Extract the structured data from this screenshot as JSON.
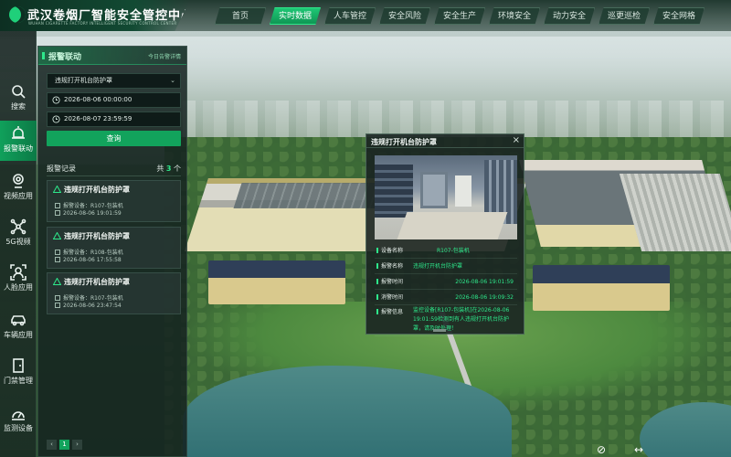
{
  "brand": {
    "title": "武汉卷烟厂智能安全管控中心",
    "subtitle": "WUHAN CIGARETTE FACTORY INTELLIGENT SECURITY CONTROL CENTER"
  },
  "nav": [
    {
      "label": "首页",
      "active": false
    },
    {
      "label": "实时数据",
      "active": true
    },
    {
      "label": "人车管控",
      "active": false
    },
    {
      "label": "安全风险",
      "active": false
    },
    {
      "label": "安全生产",
      "active": false
    },
    {
      "label": "环境安全",
      "active": false
    },
    {
      "label": "动力安全",
      "active": false
    },
    {
      "label": "巡更巡检",
      "active": false
    },
    {
      "label": "安全网格",
      "active": false
    }
  ],
  "rail": [
    {
      "label": "搜索",
      "icon": "search-icon"
    },
    {
      "label": "报警联动",
      "icon": "alarm-bell-icon",
      "active": true
    },
    {
      "label": "视频应用",
      "icon": "camera-icon"
    },
    {
      "label": "5G视频",
      "icon": "5g-network-icon"
    },
    {
      "label": "人脸应用",
      "icon": "face-scan-icon"
    },
    {
      "label": "车辆应用",
      "icon": "car-icon"
    },
    {
      "label": "门禁管理",
      "icon": "door-icon"
    },
    {
      "label": "监测设备",
      "icon": "monitor-device-icon"
    }
  ],
  "panel": {
    "title": "报警联动",
    "hint": "今日告警详情",
    "filter_type": "违规打开机台防护罩",
    "start_time": "2026-08-06 00:00:00",
    "end_time": "2026-08-07 23:59:59",
    "query_label": "查询",
    "records_label": "报警记录",
    "count_prefix": "共",
    "count": "3",
    "count_suffix": "个",
    "records": [
      {
        "title": "违规打开机台防护罩",
        "device": "报警设备：R107-包装机",
        "time": "2026-08-06 19:01:59"
      },
      {
        "title": "违规打开机台防护罩",
        "device": "报警设备：R108-包装机",
        "time": "2026-08-06 17:55:58"
      },
      {
        "title": "违规打开机台防护罩",
        "device": "报警设备：R107-包装机",
        "time": "2026-08-06 23:47:54"
      }
    ],
    "pager": {
      "prev": "‹",
      "page": "1",
      "next": "›"
    }
  },
  "popup": {
    "title": "违规打开机台防护罩",
    "close": "×",
    "fields": [
      {
        "key": "设备名称",
        "value": "R107-包装机"
      },
      {
        "key": "报警名称",
        "value": "违规打开机台防护罩"
      },
      {
        "key": "报警时间",
        "value": "2026-08-06 19:01:59"
      },
      {
        "key": "消警时间",
        "value": "2026-08-06 19:09:32"
      }
    ],
    "info_key": "报警信息",
    "info_value": "监控设备[R107-包装机]在2026-08-06 19:01:59检测到有人违规打开机台防护罩，请及时处理！"
  },
  "controls": {
    "compass": "⊘",
    "move": "↔"
  }
}
